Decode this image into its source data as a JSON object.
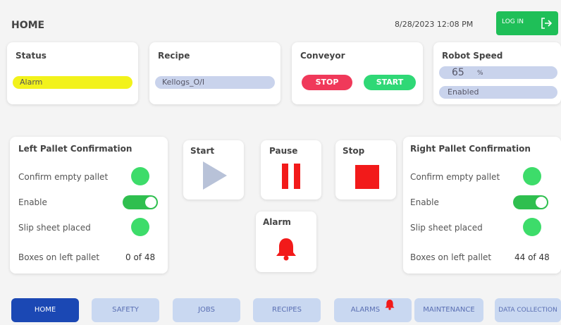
{
  "header": {
    "title": "HOME",
    "datetime": "8/28/2023 12:08 PM",
    "login_label": "LOG IN"
  },
  "status": {
    "title": "Status",
    "value": "Alarm"
  },
  "recipe": {
    "title": "Recipe",
    "value": "Kellogs_O/I"
  },
  "conveyor": {
    "title": "Conveyor",
    "stop_label": "STOP",
    "start_label": "START"
  },
  "robot_speed": {
    "title": "Robot Speed",
    "value": "65",
    "unit": "%",
    "state": "Enabled"
  },
  "left_pallet": {
    "title": "Left Pallet Confirmation",
    "confirm_label": "Confirm empty pallet",
    "enable_label": "Enable",
    "slip_label": "Slip sheet placed",
    "boxes_label": "Boxes on left pallet",
    "boxes_value": "0 of 48"
  },
  "right_pallet": {
    "title": "Right Pallet Confirmation",
    "confirm_label": "Confirm empty pallet",
    "enable_label": "Enable",
    "slip_label": "Slip sheet placed",
    "boxes_label": "Boxes on left pallet",
    "boxes_value": "44 of 48"
  },
  "controls": {
    "start_label": "Start",
    "pause_label": "Pause",
    "stop_label": "Stop",
    "alarm_label": "Alarm"
  },
  "nav": {
    "items": [
      {
        "label": "HOME"
      },
      {
        "label": "SAFETY"
      },
      {
        "label": "JOBS"
      },
      {
        "label": "RECIPES"
      },
      {
        "label": "ALARMS"
      },
      {
        "label": "MAINTENANCE"
      },
      {
        "label": "DATA COLLECTION"
      }
    ]
  },
  "colors": {
    "alarm_yellow": "#f2f21b",
    "stop_red": "#f0395a",
    "start_green": "#2fd876",
    "login_green": "#1fbf58",
    "control_red": "#f21a1a",
    "play_gray": "#b8c2d8",
    "nav_active": "#1b48b4",
    "nav_inactive": "#c9d8f1"
  },
  "icons": [
    "login-icon",
    "play-icon",
    "pause-icon",
    "stop-square-icon",
    "bell-icon"
  ]
}
